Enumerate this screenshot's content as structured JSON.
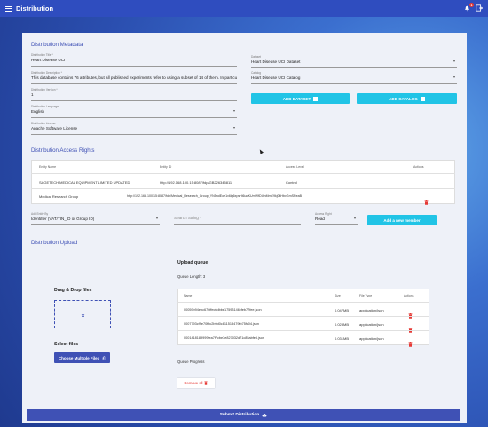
{
  "app": {
    "title": "Distribution",
    "notification_count": "1"
  },
  "metadata": {
    "section_title": "Distribution Metadata",
    "title_label": "Distribution Title *",
    "title_value": "Heart Disease UCI",
    "description_label": "Distribution Description *",
    "description_value": "This database contains 76 attributes, but all published experiments refer to using a subset of 14 of them. In particu",
    "version_label": "Distribution Version *",
    "version_value": "1",
    "language_label": "Distribution Language",
    "language_value": "English",
    "license_label": "Distribution License",
    "license_value": "Apache Software License",
    "dataset_label": "Dataset",
    "dataset_value": "Heart Disease UCI Dataset",
    "catalog_label": "Catalog",
    "catalog_value": "Heart Disease UCI Catalog",
    "add_dataset_label": "ADD DATASET",
    "add_catalog_label": "ADD CATALOG"
  },
  "access": {
    "section_title": "Distribution Access Rights",
    "columns": [
      "Entity Name",
      "Entity ID",
      "Access Level",
      "Actions"
    ],
    "rows": [
      {
        "name": "SAGETECH MEDICAL EQUIPMENT LIMITED UPDATED",
        "id": "http://192.168.100.15:8087/fdp/GB226345811",
        "level": "Control"
      },
      {
        "name": "Medical Research Group",
        "id": "http://192.168.100.15:8087/fdp/Medical_Research_Group_YN5ndEoe1v6lg6xpsHi6uqKUmWfDI4nMmE9kj0ltHbvGmSReaB",
        "level": ""
      }
    ],
    "entity_by_label": "Add Entity By",
    "entity_by_value": "Identifier (VAT/TIN_ID or Group ID)",
    "search_placeholder": "Search String *",
    "access_right_label": "Access Right",
    "access_right_value": "Read",
    "add_member_label": "Add a new member"
  },
  "upload": {
    "section_title": "Distribution Upload",
    "drag_drop_label": "Drag & Drop files",
    "select_files_label": "Select files",
    "choose_button_label": "Choose Multiple Files",
    "queue_title": "Upload queue",
    "queue_length": "Queue Length: 3",
    "columns": [
      "Name",
      "Size",
      "File Type",
      "Actions"
    ],
    "files": [
      {
        "name": "00059b94ebc676ffec6dbbe17593146cfeb77fee.json",
        "size": "0.047MB",
        "type": "application/json"
      },
      {
        "name": "0007793cf9e70fbc2b9d0c811518479fb75fc04.json",
        "size": "0.023MB",
        "type": "application/json"
      },
      {
        "name": "0001418189999fea7f7cbe3e827032d71c85abfe5.json",
        "size": "0.031MB",
        "type": "application/json"
      }
    ],
    "progress_label": "Queue Progress",
    "remove_all_label": "Remove all"
  },
  "submit_label": "Submit Distribution"
}
